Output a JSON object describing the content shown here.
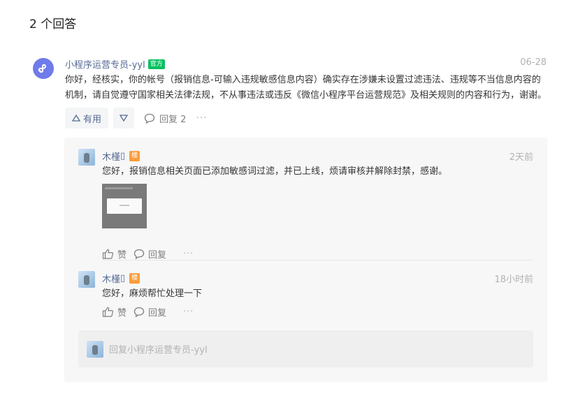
{
  "section_title": "2 个回答",
  "answer": {
    "author": "小程序运营专员-yyl",
    "badge": "官方",
    "date": "06-28",
    "body": "你好，经核实，你的帐号（报销信息-可输入违规敏感信息内容）确实存在涉嫌未设置过滤违法、违规等不当信息内容的机制，请自觉遵守国家相关法律法规，不从事违法或违反《微信小程序平台运营规范》及相关规则的内容和行为，谢谢。",
    "useful_label": "有用",
    "reply_label": "回复 2",
    "more_label": "···"
  },
  "replies": [
    {
      "author": "木槿",
      "author_tail": "▯",
      "badge": "楼",
      "time": "2天前",
      "text": "您好，报销信息相关页面已添加敏感词过滤，并已上线，烦请审核并解除封禁，感谢。",
      "has_image": true,
      "like_label": "赞",
      "reply_label": "回复",
      "more_label": "···"
    },
    {
      "author": "木槿",
      "author_tail": "▯",
      "badge": "楼",
      "time": "18小时前",
      "text": "您好，麻烦帮忙处理一下",
      "has_image": false,
      "like_label": "赞",
      "reply_label": "回复",
      "more_label": "···"
    }
  ],
  "reply_box": {
    "placeholder": "回复小程序运营专员-yyl"
  },
  "colors": {
    "link": "#576b95",
    "official_badge": "#07c160",
    "floor_badge": "#fa9d3b",
    "avatar_brand": "#6f7bea"
  },
  "icons": {
    "answer_avatar": "mini-program-logo-icon",
    "useful": "triangle-up-icon",
    "down": "triangle-down-icon",
    "comment": "comment-bubble-icon",
    "like": "thumb-up-icon"
  }
}
